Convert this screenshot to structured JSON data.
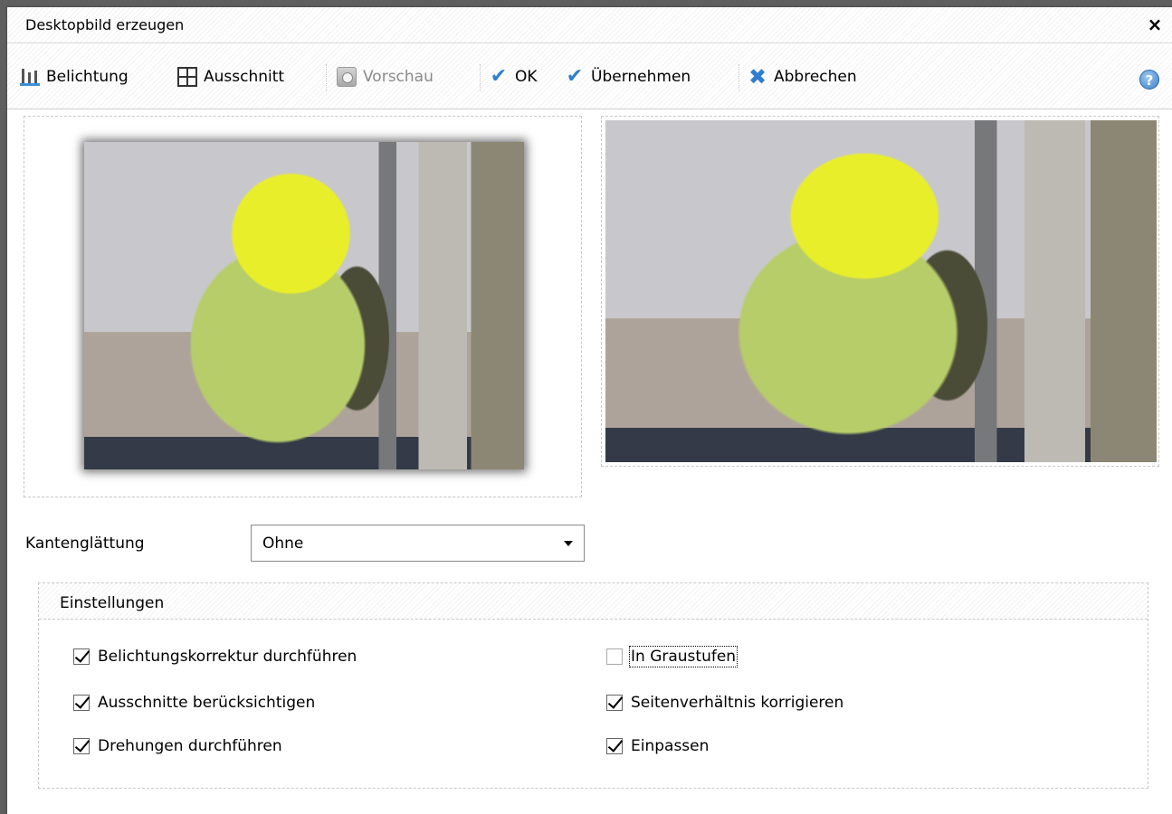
{
  "window": {
    "title": "Desktopbild erzeugen",
    "close_glyph": "×"
  },
  "toolbar": {
    "belichtung": "Belichtung",
    "ausschnitt": "Ausschnitt",
    "vorschau": "Vorschau",
    "ok": "OK",
    "uebernehmen": "Übernehmen",
    "abbrechen": "Abbrechen",
    "help_glyph": "?"
  },
  "icons": {
    "belichtung": "exposure-icon",
    "ausschnitt": "crop-icon",
    "vorschau": "preview-icon",
    "ok": "checkmark-icon",
    "uebernehmen": "checkmark-icon",
    "abbrechen": "cross-icon",
    "help": "help-icon",
    "check_glyph": "✔",
    "cross_glyph": "✖"
  },
  "kantenglaettung": {
    "label": "Kantenglättung",
    "value": "Ohne"
  },
  "einstellungen": {
    "title": "Einstellungen",
    "options_left": [
      {
        "label": "Belichtungskorrektur durchführen",
        "checked": true
      },
      {
        "label": "Ausschnitte berücksichtigen",
        "checked": true
      },
      {
        "label": "Drehungen durchführen",
        "checked": true
      }
    ],
    "options_right": [
      {
        "label": "In Graustufen",
        "checked": false
      },
      {
        "label": "Seitenverhältnis korrigieren",
        "checked": true
      },
      {
        "label": "Einpassen",
        "checked": true
      }
    ]
  },
  "colors": {
    "accent": "#2f7fd0",
    "frame": "#555555",
    "dashed_border": "#c8c8c8"
  }
}
